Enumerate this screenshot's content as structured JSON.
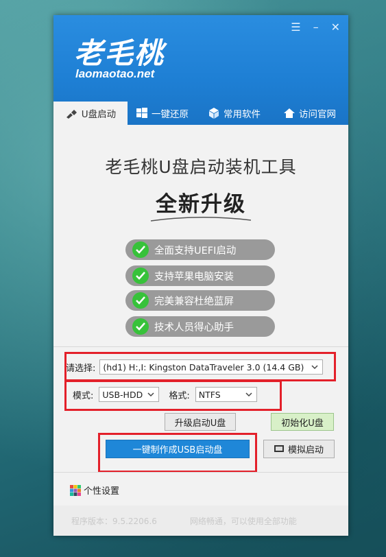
{
  "window": {
    "logo_cn": "老毛桃",
    "logo_en": "laomaotao.net",
    "controls": {
      "menu": "☰",
      "minimize": "–",
      "close": "✕"
    }
  },
  "tabs": [
    {
      "label": "U盘启动",
      "icon": "usb-icon",
      "active": true
    },
    {
      "label": "一键还原",
      "icon": "windows-icon",
      "active": false
    },
    {
      "label": "常用软件",
      "icon": "cube-icon",
      "active": false
    },
    {
      "label": "访问官网",
      "icon": "home-icon",
      "active": false
    }
  ],
  "main": {
    "title": "老毛桃U盘启动装机工具",
    "subtitle": "全新升级",
    "features": [
      "全面支持UEFI启动",
      "支持苹果电脑安装",
      "完美兼容杜绝蓝屏",
      "技术人员得心助手"
    ]
  },
  "device": {
    "label": "请选择:",
    "value": "(hd1) H:,I: Kingston DataTraveler 3.0 (14.4 GB)"
  },
  "mode": {
    "label": "模式:",
    "value": "USB-HDD"
  },
  "format": {
    "label": "格式:",
    "value": "NTFS"
  },
  "buttons": {
    "upgrade": "升级启动U盘",
    "init": "初始化U盘",
    "make": "一键制作成USB启动盘",
    "simulate": "模拟启动"
  },
  "settings": {
    "label": "个性设置"
  },
  "footer": {
    "version": "程序版本：9.5.2206.6",
    "status": "网络畅通，可以使用全部功能"
  },
  "colors": {
    "header": "#1e7fd4",
    "accent_button": "#1f87d8",
    "highlight": "#e3202a",
    "check": "#37c23a"
  }
}
